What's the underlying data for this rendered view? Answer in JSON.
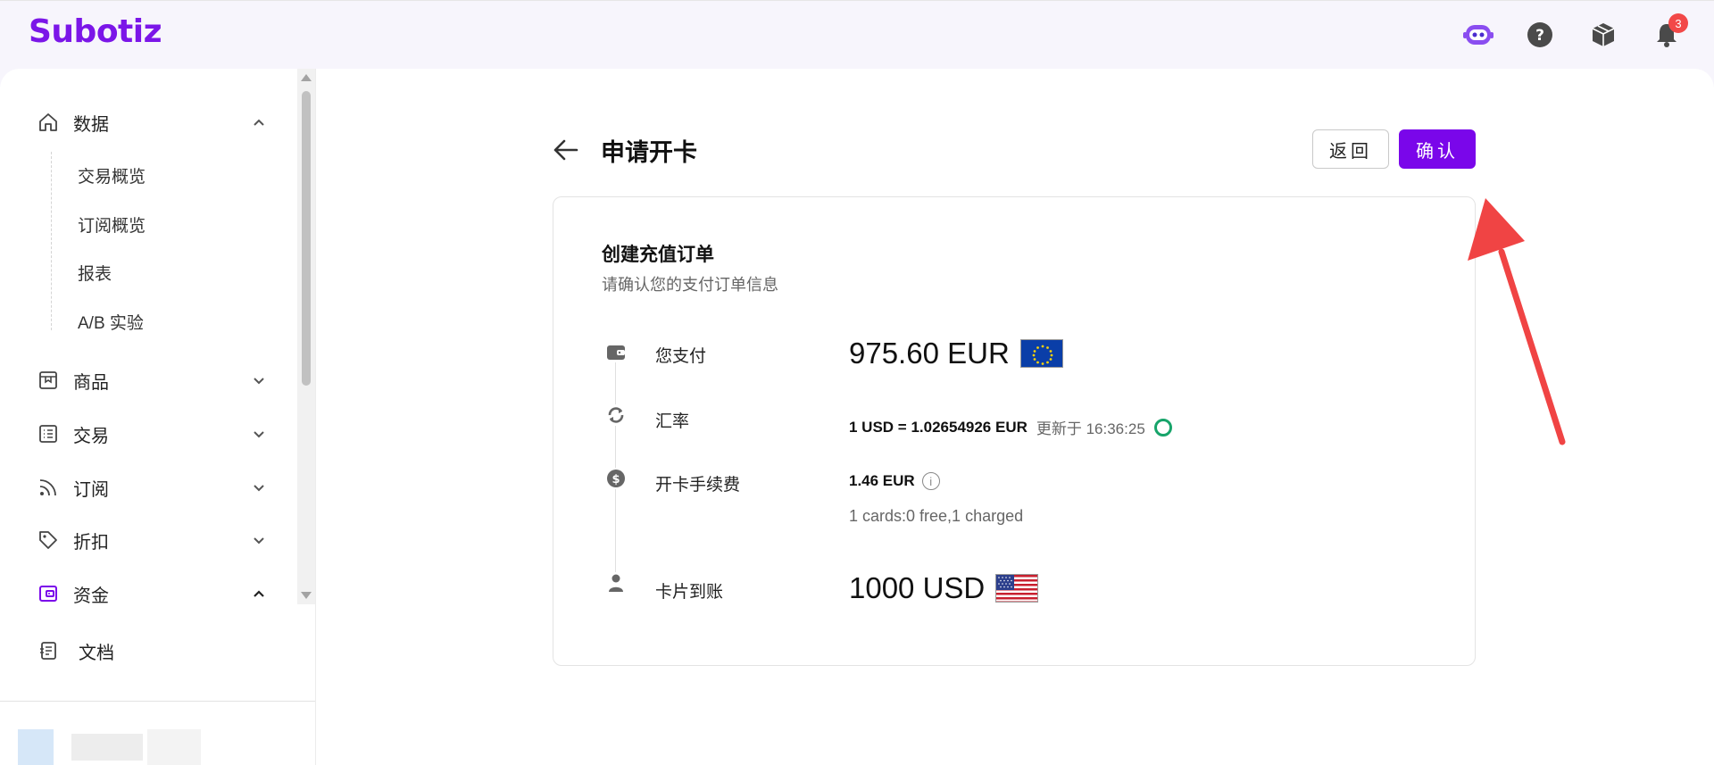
{
  "app": {
    "logo": "Subotiz",
    "notifications": "3"
  },
  "topbar": {
    "icons": [
      "bot-icon",
      "help-icon",
      "package-icon",
      "bell-icon"
    ]
  },
  "sidebar": {
    "items": [
      {
        "label": "数据",
        "icon": "home-icon",
        "expanded": true
      },
      {
        "label": "商品",
        "icon": "product-icon",
        "expanded": false
      },
      {
        "label": "交易",
        "icon": "list-icon",
        "expanded": false
      },
      {
        "label": "订阅",
        "icon": "rss-icon",
        "expanded": false
      },
      {
        "label": "折扣",
        "icon": "tag-icon",
        "expanded": false
      },
      {
        "label": "资金",
        "icon": "wallet-icon",
        "expanded": true,
        "active": true
      },
      {
        "label": "文档",
        "icon": "doc-icon"
      }
    ],
    "sub_items": [
      "交易概览",
      "订阅概览",
      "报表",
      "A/B 实验"
    ]
  },
  "header": {
    "title": "申请开卡",
    "back_label": "返回",
    "confirm_label": "确认"
  },
  "card": {
    "title": "创建充值订单",
    "subtitle": "请确认您的支付订单信息",
    "pay": {
      "label": "您支付",
      "value": "975.60 EUR"
    },
    "rate": {
      "label": "汇率",
      "value": "1 USD = 1.02654926 EUR",
      "updated": "更新于 16:36:25"
    },
    "fee": {
      "label": "开卡手续费",
      "value": "1.46 EUR",
      "note": "1 cards:0 free,1 charged"
    },
    "receive": {
      "label": "卡片到账",
      "value": "1000 USD"
    }
  },
  "colors": {
    "brand": "#7a06ea",
    "annotation": "#f04444",
    "ring": "#17a46a"
  }
}
